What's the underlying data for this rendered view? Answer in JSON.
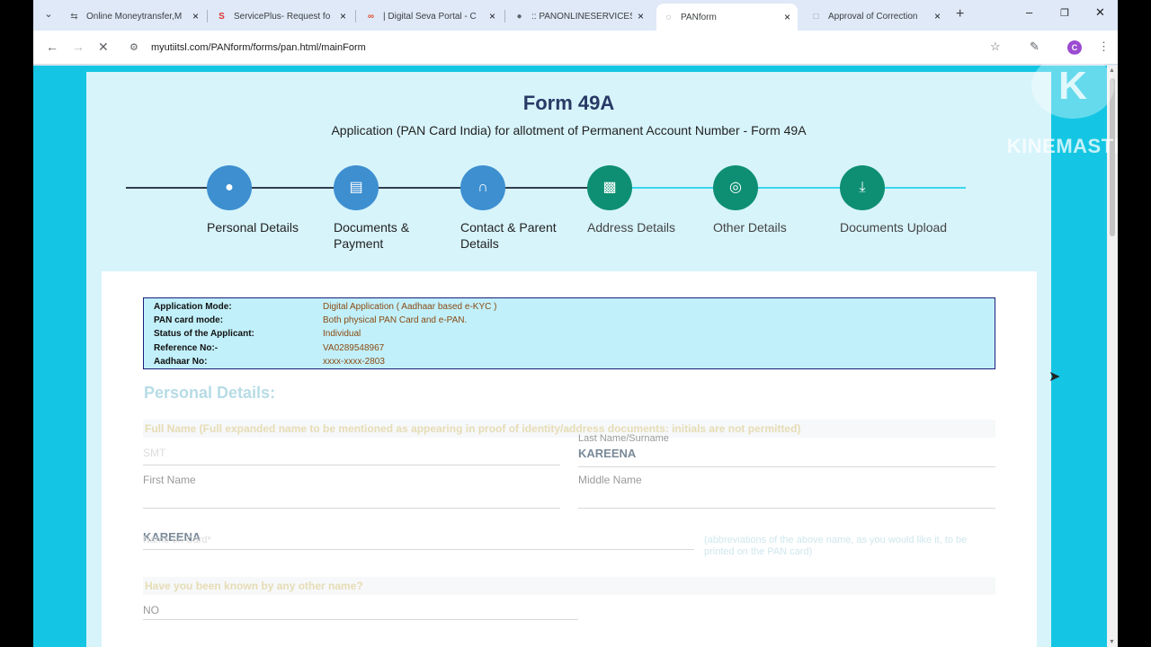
{
  "tabs": [
    {
      "title": "Online Moneytransfer,M",
      "icon": "link-icon",
      "active": false
    },
    {
      "title": "ServicePlus- Request fo",
      "icon": "serviceplus-icon",
      "active": false
    },
    {
      "title": "| Digital Seva Portal - C",
      "icon": "digital-seva-icon",
      "active": false
    },
    {
      "title": ":: PANONLINESERVICES",
      "icon": "globe-icon",
      "active": false
    },
    {
      "title": "PANform",
      "icon": "loading-icon",
      "active": true
    },
    {
      "title": "Approval of Correction",
      "icon": "page-icon",
      "active": false
    }
  ],
  "toolbar": {
    "url": "myutiitsl.com/PANform/forms/pan.html/mainForm",
    "profile_initial": "C"
  },
  "form": {
    "title": "Form 49A",
    "subtitle": "Application (PAN Card India) for allotment of Permanent Account Number - Form 49A"
  },
  "steps": [
    {
      "label": "Personal Details",
      "icon": "person-icon",
      "state": "done"
    },
    {
      "label": "Documents & Payment",
      "icon": "document-icon",
      "state": "done"
    },
    {
      "label": "Contact & Parent Details",
      "icon": "family-icon",
      "state": "done"
    },
    {
      "label": "Address Details",
      "icon": "address-card-icon",
      "state": "todo"
    },
    {
      "label": "Other Details",
      "icon": "target-icon",
      "state": "todo"
    },
    {
      "label": "Documents Upload",
      "icon": "upload-icon",
      "state": "todo"
    }
  ],
  "info": [
    {
      "key": "Application Mode:",
      "value": "Digital Application ( Aadhaar based e-KYC )"
    },
    {
      "key": "PAN card mode:",
      "value": "Both physical PAN Card and e-PAN."
    },
    {
      "key": "Status of the Applicant:",
      "value": "Individual"
    },
    {
      "key": "Reference No:-",
      "value": "VA0289548967"
    },
    {
      "key": "Aadhaar No:",
      "value": "xxxx-xxxx-2803"
    }
  ],
  "personal": {
    "section_title": "Personal Details:",
    "fullname_hint": "Full Name (Full expanded name to be mentioned as appearing in proof of identity/address documents: initials are not permitted)",
    "title_value": "SMT",
    "last_name_label": "Last Name/Surname",
    "last_name_value": "KAREENA",
    "first_name_label": "First Name",
    "middle_name_label": "Middle Name",
    "name_on_card_value": "KAREENA",
    "name_on_card_label": "Name on Card*",
    "abbr_hint": "(abbreviations of the above name, as you would like it, to be printed on the PAN card)",
    "known_hint": "Have you been known by any other name?",
    "known_value": "NO"
  },
  "watermark": {
    "text": "KINEMASTER"
  }
}
